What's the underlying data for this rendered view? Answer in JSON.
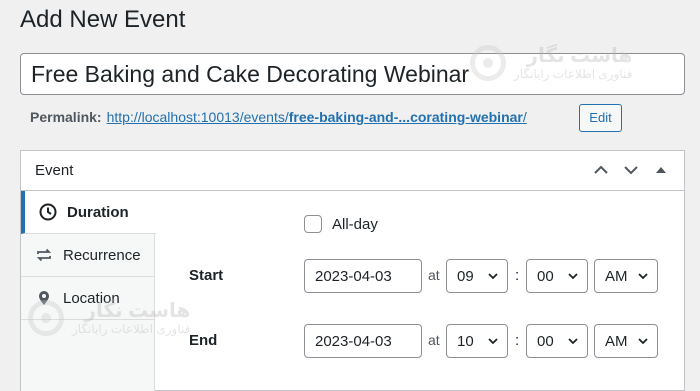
{
  "page": {
    "title": "Add New Event"
  },
  "event_title": {
    "value": "Free Baking and Cake Decorating Webinar"
  },
  "watermark": {
    "brand": "هاست نگار",
    "tagline": "فناوری اطلاعات رایانگار"
  },
  "permalink": {
    "label": "Permalink:",
    "url_base": "http://localhost:10013/events/",
    "url_slug": "free-baking-and-...corating-webinar",
    "url_trailing": "/",
    "edit_label": "Edit"
  },
  "metabox": {
    "title": "Event",
    "tabs": [
      {
        "label": "Duration",
        "icon": "clock-icon",
        "active": true
      },
      {
        "label": "Recurrence",
        "icon": "repeat-icon",
        "active": false
      },
      {
        "label": "Location",
        "icon": "pin-icon",
        "active": false
      }
    ],
    "allday_label": "All-day",
    "at_label": "at",
    "colon": ":",
    "start": {
      "label": "Start",
      "date": "2023-04-03",
      "hour": "09",
      "minute": "00",
      "ampm": "AM"
    },
    "end": {
      "label": "End",
      "date": "2023-04-03",
      "hour": "10",
      "minute": "00",
      "ampm": "AM"
    }
  },
  "colors": {
    "accent": "#2271b1",
    "background": "#f0f0f1",
    "text": "#1d2327"
  }
}
